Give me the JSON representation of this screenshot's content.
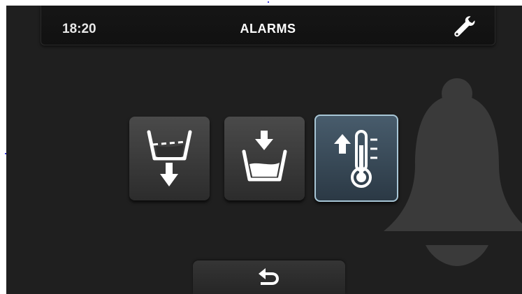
{
  "header": {
    "time": "18:20",
    "title": "ALARMS",
    "settings_icon": "wrench-icon"
  },
  "alarms": {
    "tiles": [
      {
        "icon": "drain-alarm-icon",
        "selected": false
      },
      {
        "icon": "fill-alarm-icon",
        "selected": false
      },
      {
        "icon": "temperature-high-alarm-icon",
        "selected": true
      }
    ],
    "background_icon": "bell-icon"
  },
  "footer": {
    "back_icon": "back-arrow-icon"
  },
  "colors": {
    "screen_bg": "#1f1f1f",
    "tile_bg": "#3c3c3c",
    "selected_tile_bg": "#3a4b59",
    "selected_border": "#a8c6d6",
    "icon": "#ffffff"
  }
}
